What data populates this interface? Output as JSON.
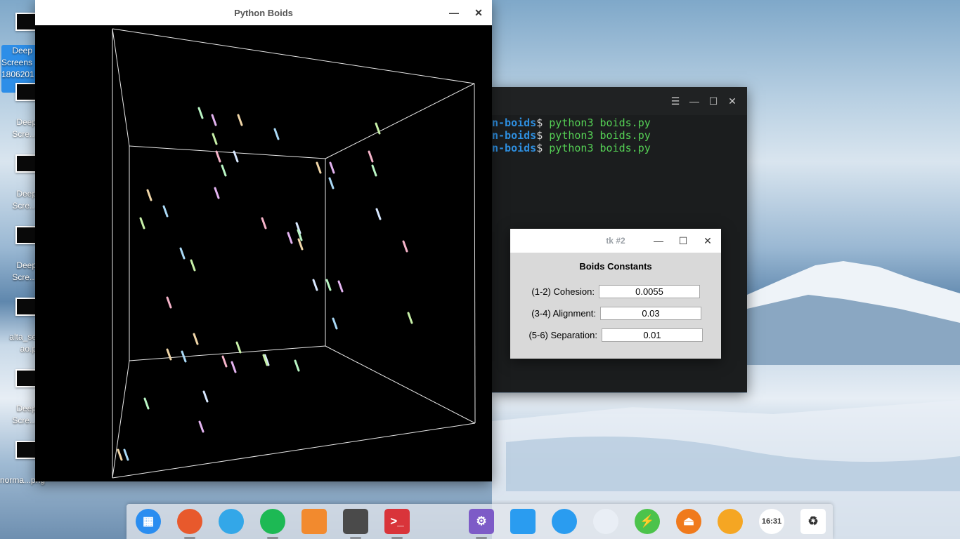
{
  "desktop": {
    "icons": [
      {
        "label": "",
        "selected": false
      },
      {
        "label": "Deep\nScreens\n1806201\n.png",
        "selected": true
      },
      {
        "label": "Deep\nScre...",
        "selected": false
      },
      {
        "label": "Deep\nScre...",
        "selected": false
      },
      {
        "label": "Deep\nScre...",
        "selected": false
      },
      {
        "label": "alta_se\nao.p",
        "selected": false
      },
      {
        "label": "Deep\nScre...",
        "selected": false
      },
      {
        "label": "norma...png",
        "selected": false
      }
    ]
  },
  "boids_window": {
    "title": "Python Boids",
    "minimize_icon": "minimize-icon",
    "close_icon": "close-icon"
  },
  "terminal": {
    "lines": [
      {
        "path": "n-boids",
        "prompt": "$ ",
        "command": "python3 boids.py"
      },
      {
        "path": "n-boids",
        "prompt": "$ ",
        "command": "python3 boids.py"
      },
      {
        "path": "n-boids",
        "prompt": "$ ",
        "command": "python3 boids.py"
      }
    ]
  },
  "tk_dialog": {
    "title": "tk #2",
    "heading": "Boids Constants",
    "fields": [
      {
        "label": "(1-2) Cohesion:",
        "value": "0.0055"
      },
      {
        "label": "(3-4) Alignment:",
        "value": "0.03"
      },
      {
        "label": "(5-6) Separation:",
        "value": "0.01"
      }
    ]
  },
  "dock": {
    "items": [
      {
        "name": "launcher-icon",
        "glyph": "▦",
        "color": "#2a8df0"
      },
      {
        "name": "firefox-icon",
        "glyph": "",
        "color": "#e8592c"
      },
      {
        "name": "file-manager-icon",
        "glyph": "",
        "color": "#33a7e8"
      },
      {
        "name": "spotify-icon",
        "glyph": "",
        "color": "#1db954"
      },
      {
        "name": "app-store-icon",
        "glyph": "",
        "color": "#f28a2e"
      },
      {
        "name": "sublime-text-icon",
        "glyph": "",
        "color": "#4a4a4a"
      },
      {
        "name": "terminal-icon",
        "glyph": ">_",
        "color": "#d9343a"
      },
      {
        "name": "settings-icon",
        "glyph": "⚙",
        "color": "#7d5bc7"
      },
      {
        "name": "screenshot-icon",
        "glyph": "",
        "color": "#2a9cf0"
      },
      {
        "name": "wifi-icon",
        "glyph": "",
        "color": "#2a9cf0"
      },
      {
        "name": "dropbox-icon",
        "glyph": "",
        "color": "#e9eef5"
      },
      {
        "name": "power-icon",
        "glyph": "⚡",
        "color": "#4cc34b"
      },
      {
        "name": "eject-icon",
        "glyph": "⏏",
        "color": "#f07a1c"
      },
      {
        "name": "timer-icon",
        "glyph": "",
        "color": "#f5a623"
      },
      {
        "name": "clock-icon",
        "glyph": "16:31",
        "color": "#ffffff"
      },
      {
        "name": "trash-icon",
        "glyph": "♻",
        "color": "#ffffff"
      }
    ]
  }
}
